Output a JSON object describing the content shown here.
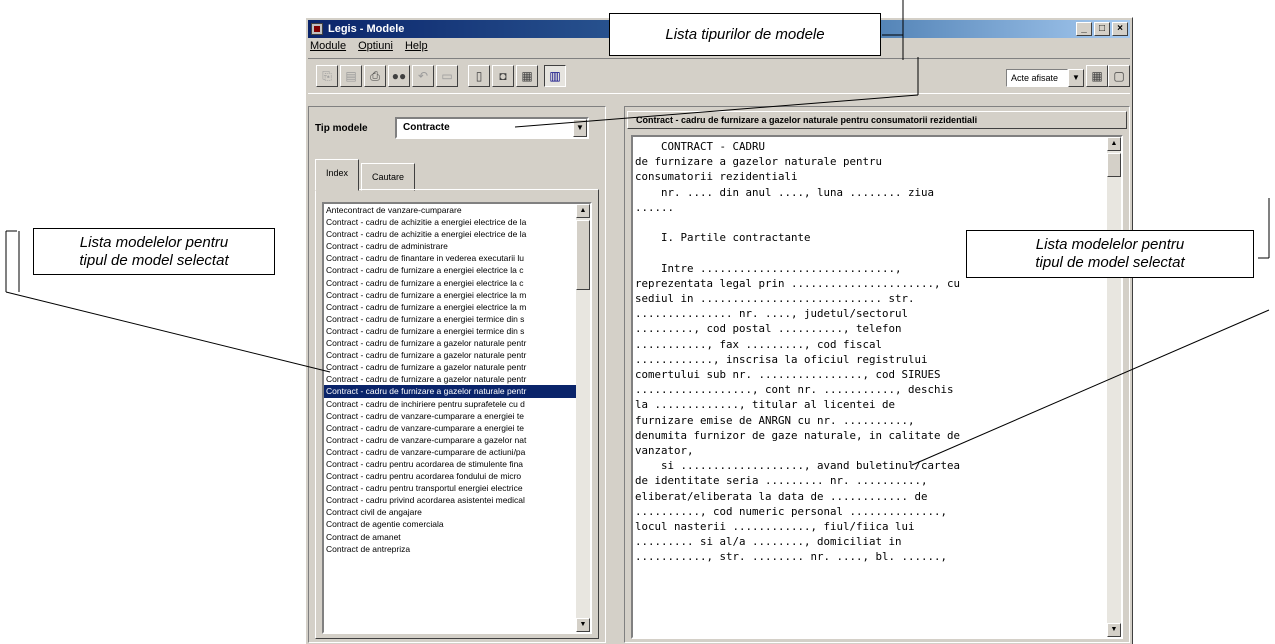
{
  "window": {
    "title": "Legis - Modele",
    "minimize_glyph": "_",
    "maximize_glyph": "□",
    "close_glyph": "×"
  },
  "menu": [
    "Module",
    "Optiuni",
    "Help"
  ],
  "toolbar": {
    "acte_label": "Acte afisate",
    "icons": [
      "copy-icon",
      "paste-icon",
      "print-icon",
      "find-icon",
      "undo-icon",
      "window-icon",
      "new-doc-icon",
      "save-icon",
      "calc-icon",
      "grid-view-icon",
      "options-icon",
      "view-icon"
    ]
  },
  "tip_modele": {
    "label": "Tip modele",
    "value": "Contracte"
  },
  "tabs": [
    "Index",
    "Cautare"
  ],
  "models_list": {
    "selected_index": 15,
    "items": [
      "Antecontract de vanzare-cumparare",
      "Contract - cadru de achizitie a energiei electrice de la",
      "Contract - cadru de achizitie a energiei electrice de la",
      "Contract - cadru de administrare",
      "Contract - cadru de finantare in vederea executarii lu",
      "Contract - cadru de furnizare a energiei electrice la c",
      "Contract - cadru de furnizare a energiei electrice la c",
      "Contract - cadru de furnizare a energiei electrice la m",
      "Contract - cadru de furnizare a energiei electrice la m",
      "Contract - cadru de furnizare a energiei termice din s",
      "Contract - cadru de furnizare a energiei termice din s",
      "Contract - cadru de furnizare a gazelor naturale pentr",
      "Contract - cadru de furnizare a gazelor naturale pentr",
      "Contract - cadru de furnizare a gazelor naturale pentr",
      "Contract - cadru de furnizare a gazelor naturale pentr",
      "Contract - cadru de furnizare a gazelor naturale pentr",
      "Contract - cadru de inchiriere pentru suprafetele cu d",
      "Contract - cadru de vanzare-cumparare a energiei te",
      "Contract - cadru de vanzare-cumparare a energiei te",
      "Contract - cadru de vanzare-cumparare a gazelor nat",
      "Contract - cadru de vanzare-cumparare de actiuni/pa",
      "Contract - cadru pentru acordarea de stimulente fina",
      "Contract - cadru pentru acordarea fondului de micro",
      "Contract - cadru pentru transportul energiei electrice",
      "Contract - cadru privind acordarea asistentei medical",
      "Contract civil de angajare",
      "Contract de agentie comerciala",
      "Contract de amanet",
      "Contract de antrepriza"
    ]
  },
  "document": {
    "title": "Contract - cadru de furnizare a gazelor naturale pentru consumatorii rezidentiali",
    "lines": [
      "    CONTRACT - CADRU",
      "de furnizare a gazelor naturale pentru",
      "consumatorii rezidentiali",
      "    nr. .... din anul ...., luna ........ ziua",
      "......",
      "",
      "    I. Partile contractante",
      "",
      "    Intre ..............................,",
      "reprezentata legal prin ......................, cu",
      "sediul in ............................ str.",
      "............... nr. ...., judetul/sectorul",
      "........., cod postal .........., telefon",
      "..........., fax ........., cod fiscal",
      "............, inscrisa la oficiul registrului",
      "comertului sub nr. ................, cod SIRUES",
      ".................., cont nr. ..........., deschis",
      "la ............., titular al licentei de",
      "furnizare emise de ANRGN cu nr. ..........,",
      "denumita furnizor de gaze naturale, in calitate de",
      "vanzator,",
      "    si ..................., avand buletinul/cartea",
      "de identitate seria ......... nr. ..........,",
      "eliberat/eliberata la data de ............ de",
      ".........., cod numeric personal ..............,",
      "locul nasterii ............, fiul/fiica lui",
      "......... si al/a ........, domiciliat in",
      "..........., str. ........ nr. ...., bl. ......,"
    ]
  },
  "callouts": {
    "top": "Lista tipurilor de modele",
    "left": "Lista modelelor pentru\ntipul de model selectat",
    "right": "Lista modelelor pentru\ntipul de model selectat"
  }
}
